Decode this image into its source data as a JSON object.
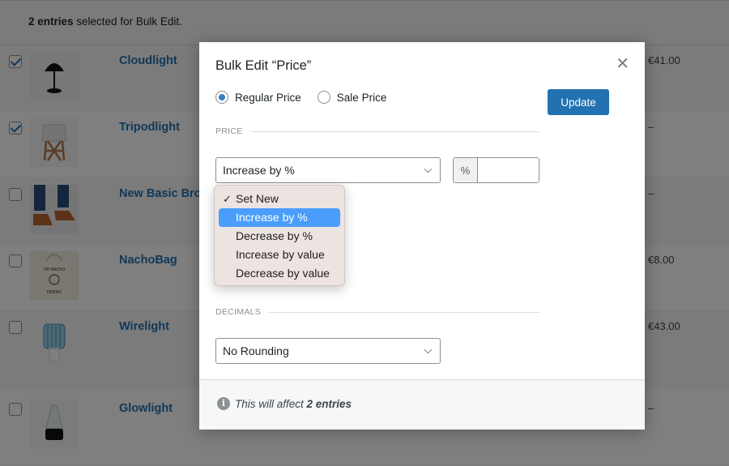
{
  "notice": {
    "count_bold": "2 entries",
    "rest": " selected for Bulk Edit."
  },
  "rows": [
    {
      "name": "Cloudlight",
      "price": "€41.00",
      "checked": true,
      "thumb": "black-dome-lamp"
    },
    {
      "name": "Tripodlight",
      "price": "–",
      "checked": true,
      "thumb": "tripod-lamp"
    },
    {
      "name": "New Basic Brown Shoes",
      "price": "–",
      "checked": false,
      "thumb": "brown-shoes"
    },
    {
      "name": "NachoBag",
      "price": "€8.00",
      "checked": false,
      "thumb": "tote-bag"
    },
    {
      "name": "Wirelight",
      "price": "€43.00",
      "checked": false,
      "thumb": "blue-wire-lamp"
    },
    {
      "name": "Glowlight",
      "price": "–",
      "checked": false,
      "thumb": "glass-lamp"
    }
  ],
  "modal": {
    "title": "Bulk Edit “Price”",
    "close_icon": "close-icon",
    "radios": [
      {
        "label": "Regular Price",
        "selected": true
      },
      {
        "label": "Sale Price",
        "selected": false
      }
    ],
    "update_label": "Update",
    "price_section_label": "PRICE",
    "price_mode_select": {
      "value": "Increase by %",
      "options": [
        "Set New",
        "Increase by %",
        "Decrease by %",
        "Increase by value",
        "Decrease by value"
      ],
      "checked_option": "Set New",
      "highlighted_option": "Increase by %"
    },
    "percent_addon": "%",
    "percent_value": "",
    "decimals_section_label": "DECIMALS",
    "decimals_select": {
      "value": "No Rounding"
    },
    "footer": {
      "prefix": "This will affect ",
      "count_bold": "2 entries"
    }
  },
  "colors": {
    "accent": "#2271b1",
    "highlight": "#4a9dfb"
  }
}
